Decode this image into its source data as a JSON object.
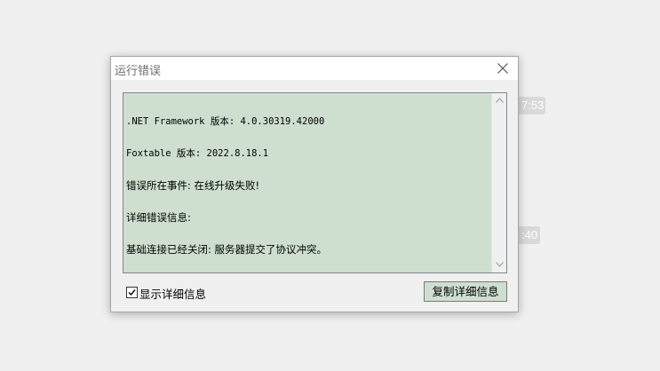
{
  "background": {
    "chip_top": "7:53",
    "chip_bottom": ":40"
  },
  "dialog": {
    "title": "运行错误",
    "close_icon": "close-icon",
    "text_lines": [
      ".NET Framework 版本: 4.0.30319.42000",
      "Foxtable 版本: 2022.8.18.1",
      "错误所在事件: 在线升级失败!",
      "详细错误信息:",
      "基础连接已经关闭: 服务器提交了协议冲突。"
    ],
    "show_details_label": "显示详细信息",
    "show_details_checked": true,
    "copy_button_label": "复制详细信息"
  },
  "colors": {
    "text_area_bg": "#cedfd0",
    "button_bg": "#cedfd0",
    "dialog_bg": "#f0f0f0"
  }
}
